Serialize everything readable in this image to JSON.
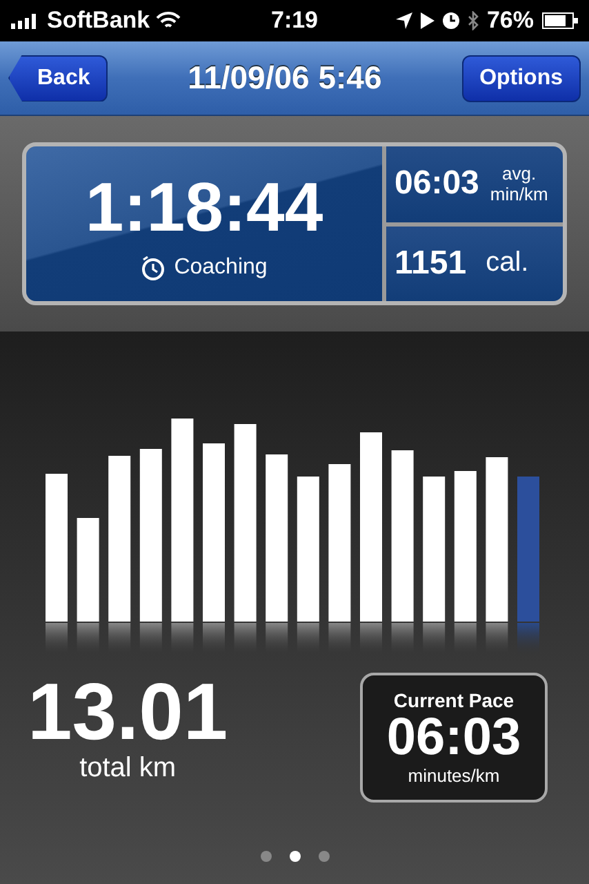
{
  "status_bar": {
    "carrier": "SoftBank",
    "time": "7:19",
    "battery": "76%"
  },
  "nav_bar": {
    "back": "Back",
    "title": "11/09/06 5:46",
    "action": "Options"
  },
  "summary": {
    "duration": "1:18:44",
    "mode": "Coaching",
    "avg_pace": "06:03",
    "avg_pace_unit_1": "avg.",
    "avg_pace_unit_2": "min/km",
    "calories": "1151",
    "calories_unit": "cal."
  },
  "distance": {
    "value": "13.01",
    "unit": "total km"
  },
  "current_pace": {
    "title": "Current Pace",
    "value": "06:03",
    "unit": "minutes/km"
  },
  "pages": [
    {
      "selected": false
    },
    {
      "selected": true
    },
    {
      "selected": false
    }
  ]
}
